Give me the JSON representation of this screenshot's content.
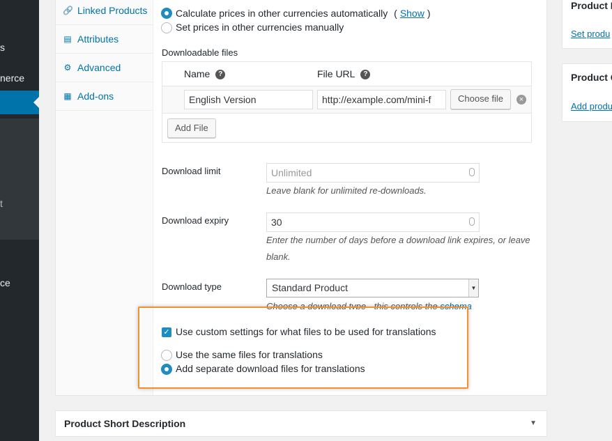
{
  "admin_menu": {
    "items": [
      "s",
      "nerce",
      "t",
      "ce"
    ]
  },
  "tabs": [
    {
      "label": "Linked Products",
      "icon": "link-icon"
    },
    {
      "label": "Attributes",
      "icon": "list-icon"
    },
    {
      "label": "Advanced",
      "icon": "gear-icon"
    },
    {
      "label": "Add-ons",
      "icon": "addons-icon"
    }
  ],
  "pricing": {
    "auto_label": "Calculate prices in other currencies automatically",
    "show_open": "(",
    "show_link": "Show",
    "show_close": ")",
    "manual_label": "Set prices in other currencies manually"
  },
  "downloadable": {
    "heading": "Downloadable files",
    "col_name": "Name",
    "col_url": "File URL",
    "help_glyph": "?",
    "file_name": "English Version",
    "file_url": "http://example.com/mini-f",
    "choose_file": "Choose file",
    "add_file": "Add File"
  },
  "download_limit": {
    "label": "Download limit",
    "placeholder": "Unlimited",
    "hint": "Leave blank for unlimited re-downloads."
  },
  "download_expiry": {
    "label": "Download expiry",
    "value": "30",
    "hint_line1": "Enter the number of days before a download link expires, or leave",
    "hint_line2": "blank."
  },
  "download_type": {
    "label": "Download type",
    "value": "Standard Product",
    "hint": "Choose a download type - this controls the",
    "hint_link": "schema"
  },
  "translations": {
    "custom_label": "Use custom settings for what files to be used for translations",
    "same_label": "Use the same files for translations",
    "separate_label": "Add separate download files for translations"
  },
  "short_description": {
    "title": "Product Short Description"
  },
  "sidebar": {
    "box1_title": "Product I",
    "box1_link": "Set produ",
    "box2_title": "Product C",
    "box2_link": "Add produ"
  },
  "colors": {
    "accent": "#0073aa",
    "highlight": "#f0902f",
    "admin_bg": "#23282d"
  }
}
